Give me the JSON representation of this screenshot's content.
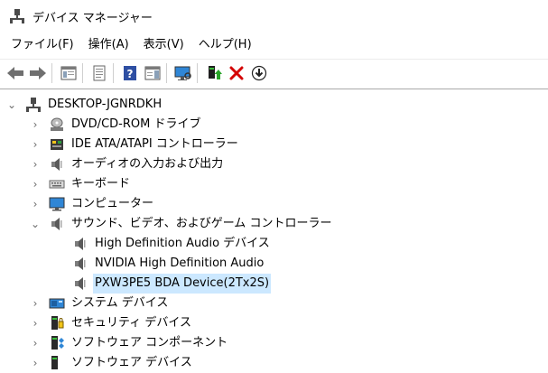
{
  "window": {
    "title": "デバイス マネージャー"
  },
  "menu": [
    "ファイル(F)",
    "操作(A)",
    "表示(V)",
    "ヘルプ(H)"
  ],
  "toolbar": [
    "back-icon",
    "forward-icon",
    "properties-pane-icon",
    "document-icon",
    "help-icon",
    "action-pane-icon",
    "monitor-scan-icon",
    "update-driver-icon",
    "uninstall-icon",
    "download-icon"
  ],
  "tree": {
    "root": {
      "label": "DESKTOP-JGNRDKH",
      "expanded": true
    },
    "items": [
      {
        "label": "DVD/CD-ROM ドライブ",
        "icon": "dvd-drive-icon",
        "expanded": false
      },
      {
        "label": "IDE ATA/ATAPI コントローラー",
        "icon": "ide-controller-icon",
        "expanded": false
      },
      {
        "label": "オーディオの入力および出力",
        "icon": "speaker-icon",
        "expanded": false
      },
      {
        "label": "キーボード",
        "icon": "keyboard-icon",
        "expanded": false
      },
      {
        "label": "コンピューター",
        "icon": "computer-icon",
        "expanded": false
      },
      {
        "label": "サウンド、ビデオ、およびゲーム コントローラー",
        "icon": "speaker-icon",
        "expanded": true,
        "children": [
          {
            "label": "High Definition Audio デバイス",
            "icon": "speaker-icon"
          },
          {
            "label": "NVIDIA High Definition Audio",
            "icon": "speaker-icon"
          },
          {
            "label": "PXW3PE5 BDA Device(2Tx2S)",
            "icon": "speaker-icon",
            "selected": true
          }
        ]
      },
      {
        "label": "システム デバイス",
        "icon": "system-device-icon",
        "expanded": false
      },
      {
        "label": "セキュリティ デバイス",
        "icon": "security-device-icon",
        "expanded": false
      },
      {
        "label": "ソフトウェア コンポーネント",
        "icon": "software-component-icon",
        "expanded": false
      },
      {
        "label": "ソフトウェア デバイス",
        "icon": "software-device-icon",
        "expanded": false
      }
    ]
  }
}
